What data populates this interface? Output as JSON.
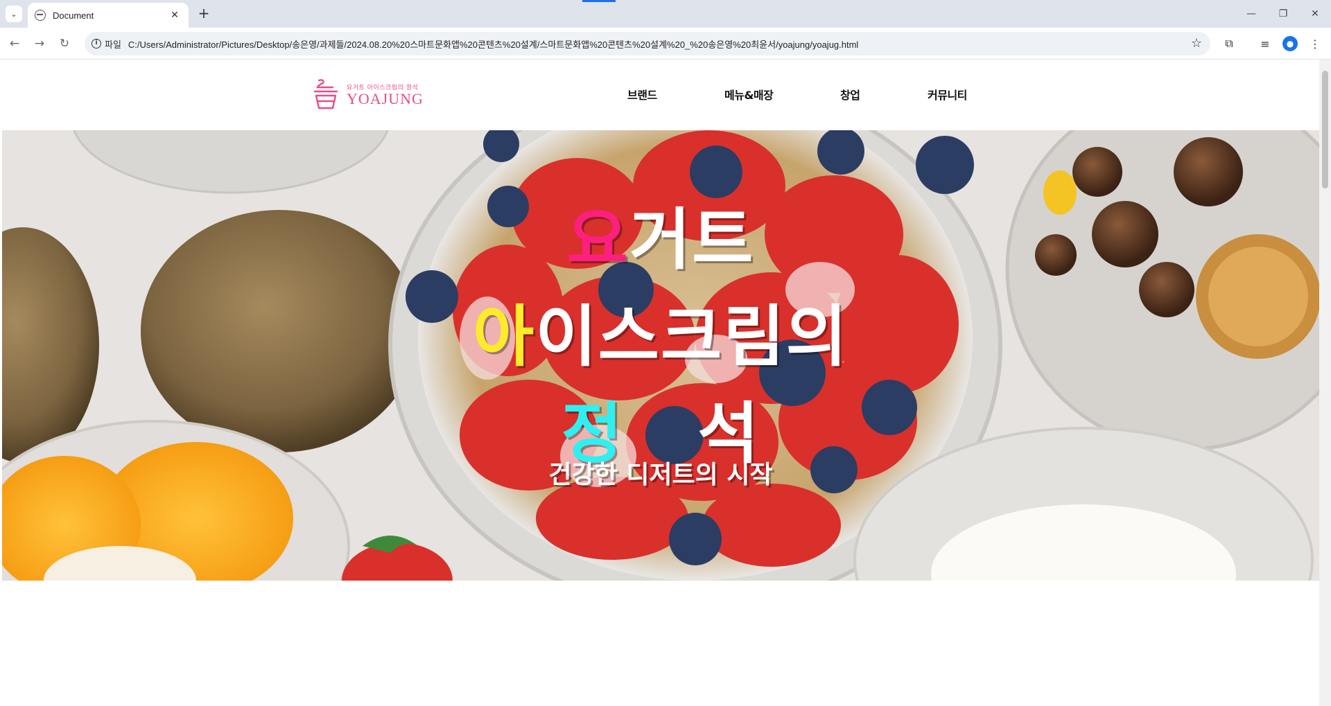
{
  "browser": {
    "tab_title": "Document",
    "scheme_label": "파일",
    "url": "C:/Users/Administrator/Pictures/Desktop/송은영/과제들/2024.08.20%20스마트문화앱%20콘텐츠%20설계/스마트문화앱%20콘텐츠%20설계%20_%20송은영%20최윤서/yoajung/yoajug.html"
  },
  "logo": {
    "tagline": "요거트 아이스크림의 정석",
    "name": "YOAJUNG",
    "color": "#e84d8a"
  },
  "nav": {
    "items": [
      "브랜드",
      "메뉴&매장",
      "창업",
      "커뮤니티"
    ]
  },
  "hero": {
    "line1": {
      "accent": "요",
      "rest": "거트"
    },
    "line2": {
      "accent": "아",
      "rest": "이스크림의"
    },
    "line3": {
      "accent": "정",
      "rest": "석"
    },
    "subtitle": "건강한 디저트의 시작",
    "colors": {
      "pink": "#ff1f7e",
      "yellow": "#ffeb2a",
      "cyan": "#2ff0f0"
    }
  }
}
